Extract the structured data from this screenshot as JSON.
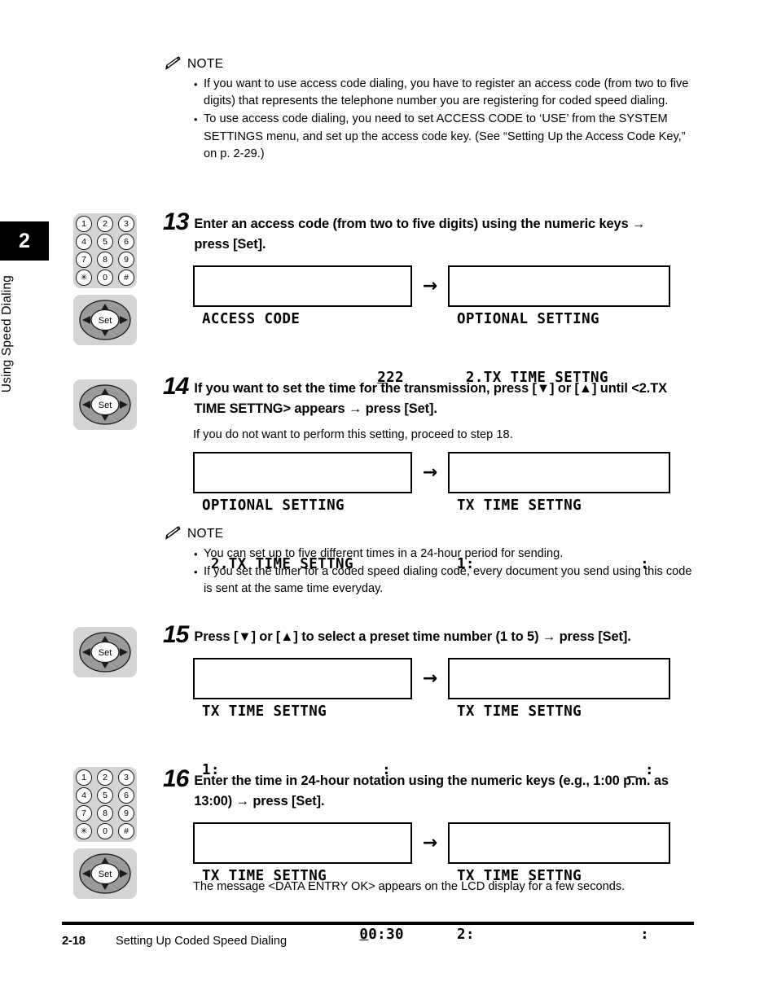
{
  "sidebar": {
    "chapter_number": "2",
    "chapter_title": "Using Speed Dialing"
  },
  "notes": [
    {
      "label": "NOTE",
      "items": [
        "If you want to use access code dialing, you have to register an access code (from two to five digits) that represents the telephone number you are registering for coded speed dialing.",
        "To use access code dialing, you need to set ACCESS CODE to ‘USE’ from the SYSTEM SETTINGS menu, and set up the access code key. (See “Setting Up the Access Code Key,” on p. 2-29.)"
      ]
    },
    {
      "label": "NOTE",
      "items": [
        "You can set up to five different times in a 24-hour period for sending.",
        "If you set the timer for a coded speed dialing code, every document you send using this code is sent at the same time everyday."
      ]
    }
  ],
  "keypad": {
    "keys": [
      "1",
      "2",
      "3",
      "4",
      "5",
      "6",
      "7",
      "8",
      "9",
      "✳",
      "0",
      "#"
    ]
  },
  "setpad": {
    "center_label": "Set"
  },
  "steps": [
    {
      "number": "13",
      "text": "Enter an access code (from two to five digits) using the numeric keys → press [Set].",
      "lcd_left": {
        "line1": "ACCESS CODE",
        "line2_cursor": "2",
        "line2_rest": "22"
      },
      "arrow": "→",
      "lcd_right": {
        "line1": "OPTIONAL SETTING",
        "line2": " 2.TX TIME SETTNG"
      }
    },
    {
      "number": "14",
      "text": "If you want to set the time for the transmission, press [▼] or [▲] until <2.TX TIME SETTNG> appears → press [Set].",
      "subtext": "If you do not want to perform this setting, proceed to step 18.",
      "lcd_left": {
        "line1": "OPTIONAL SETTING",
        "line2": " 2.TX TIME SETTNG"
      },
      "arrow": "→",
      "lcd_right": {
        "line1": "TX TIME SETTNG",
        "line2_left": "1:",
        "line2_right": ":"
      }
    },
    {
      "number": "15",
      "text": "Press [▼] or [▲] to select a preset time number (1 to 5) → press [Set].",
      "lcd_left": {
        "line1": "TX TIME SETTNG",
        "line2_left": "1:",
        "line2_right": ":"
      },
      "arrow": "→",
      "lcd_right": {
        "line1": "TX TIME SETTNG",
        "line2_right": "_ :"
      }
    },
    {
      "number": "16",
      "text": "Enter the time in 24-hour notation using the numeric keys (e.g., 1:00 p.m. as 13:00) → press [Set].",
      "lcd_left": {
        "line1": "TX TIME SETTNG",
        "line2_cursor": "0",
        "line2_rest": "0:30"
      },
      "arrow": "→",
      "lcd_right": {
        "line1": "TX TIME SETTNG",
        "line2_left": "2:",
        "line2_right": ":"
      },
      "aftertext": "The message <DATA ENTRY OK> appears on the LCD display for a few seconds."
    }
  ],
  "footer": {
    "page_number": "2-18",
    "section_title": "Setting Up Coded Speed Dialing"
  }
}
